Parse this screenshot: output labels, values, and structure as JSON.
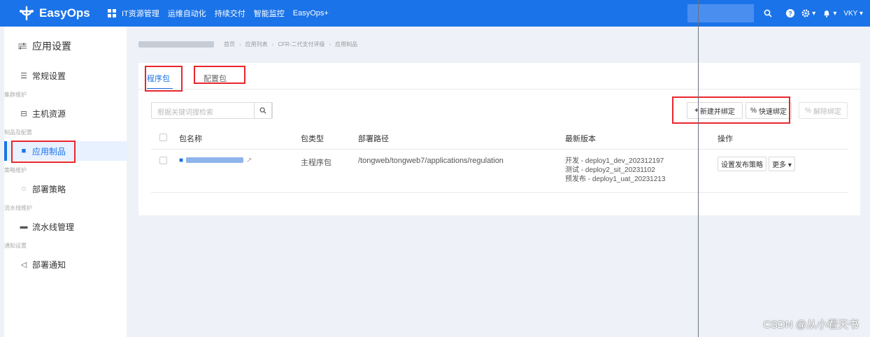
{
  "brand": {
    "name": "EasyOps",
    "color": "#1a73e8"
  },
  "nav": {
    "items": [
      "IT资源管理",
      "运维自动化",
      "持续交付",
      "智能监控",
      "EasyOps+"
    ]
  },
  "topright": {
    "user": "VKY"
  },
  "sidebar": {
    "title": "应用设置",
    "sections": [
      {
        "item": "常规设置",
        "icon": "list-icon"
      },
      {
        "group": "集群维护",
        "item": "主机资源",
        "icon": "host-icon"
      },
      {
        "group": "制品及配置",
        "item": "应用制品",
        "icon": "package-icon",
        "active": true
      },
      {
        "group": "策略维护",
        "item": "部署策略",
        "icon": "strategy-icon"
      },
      {
        "group": "流水线维护",
        "item": "流水线管理",
        "icon": "pipeline-icon"
      },
      {
        "group": "通知设置",
        "item": "部署通知",
        "icon": "notify-icon"
      }
    ]
  },
  "breadcrumb": [
    "首页",
    "应用列表",
    "CFR-二代支付评级",
    "应用制品"
  ],
  "tabs": [
    "程序包",
    "配置包"
  ],
  "search": {
    "placeholder": "根据关键词搜检索"
  },
  "buttons": {
    "create_bind": "新建并绑定",
    "quick_bind": "快速绑定",
    "unbind": "解除绑定"
  },
  "table": {
    "headers": [
      "包名称",
      "包类型",
      "部署路径",
      "最新版本",
      "操作"
    ],
    "rows": [
      {
        "type": "主程序包",
        "path": "/tongweb/tongweb7/applications/regulation",
        "versions": [
          "开发 - deploy1_dev_202312197",
          "测试 - deploy2_sit_20231102",
          "预发布 - deploy1_uat_20231213"
        ],
        "actions": [
          "设置发布策略",
          "更多"
        ]
      }
    ]
  },
  "watermark": "CSDN @从小看天书"
}
